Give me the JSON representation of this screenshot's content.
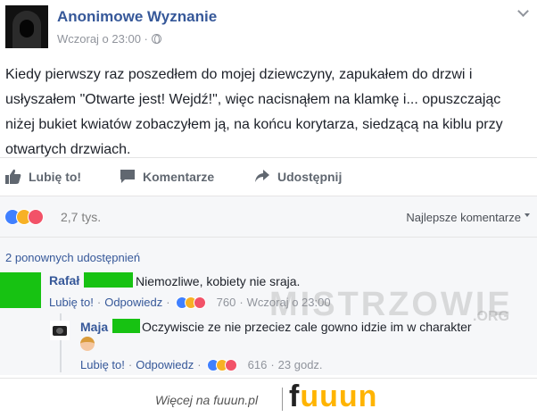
{
  "post": {
    "page_name": "Anonimowe Wyznanie",
    "timestamp": "Wczoraj o 23:00 ·",
    "text": "Kiedy pierwszy raz poszedłem do mojej dziewczyny, zapukałem do drzwi i usłyszałem \"Otwarte jest! Wejdź!\", więc nacisnąłem na klamkę i... opuszczając niżej bukiet kwiatów zobaczyłem ją, na końcu korytarza, siedzącą na kiblu przy otwartych drzwiach."
  },
  "actions": {
    "like": "Lubię to!",
    "comment": "Komentarze",
    "share": "Udostępnij"
  },
  "reactions": {
    "count": "2,7 tys.",
    "sort_label": "Najlepsze komentarze"
  },
  "shares_text": "2 ponownych udostępnień",
  "comments": [
    {
      "author": "Rafał",
      "text": "Niemozliwe, kobiety nie sraja.",
      "like_label": "Lubię to!",
      "reply_label": "Odpowiedz",
      "reactions": "760",
      "time": "Wczoraj o 23:00"
    }
  ],
  "reply": {
    "author": "Maja",
    "text": "Oczywiscie ze nie przeciez cale gowno idzie im w charakter",
    "like_label": "Lubię to!",
    "reply_label": "Odpowiedz",
    "reactions": "616",
    "time": "23 godz."
  },
  "watermark": {
    "text": "MISTRZOWIE",
    "suffix": ".ORG"
  },
  "footer": {
    "text": "Więcej na fuuun.pl",
    "logo_f": "f",
    "logo_rest": "uuun"
  },
  "colors": {
    "link": "#365899",
    "redaction": "#17c212",
    "logo": "#ffb400"
  }
}
